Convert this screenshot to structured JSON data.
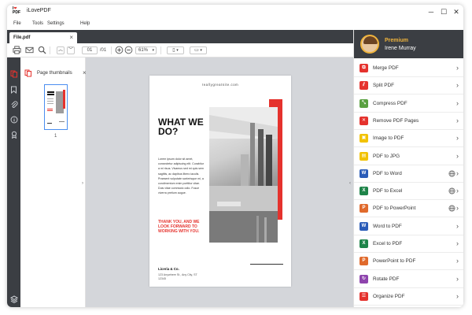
{
  "app": {
    "title": "iLovePDF",
    "logo_text": "I❤PDF"
  },
  "window_controls": {
    "minimize": "─",
    "maximize": "☐",
    "close": "✕"
  },
  "menu": [
    "File",
    "Tools",
    "Settings",
    "Help"
  ],
  "tab": {
    "label": "File.pdf",
    "close": "×"
  },
  "toolbar": {
    "page_current": "01",
    "page_total": "/01",
    "zoom": "61%",
    "icons": [
      "print-icon",
      "mail-icon",
      "search-icon",
      "page-up-icon",
      "page-down-icon",
      "zoom-in-icon",
      "zoom-out-icon",
      "page-view-icon",
      "rotate-page-icon"
    ]
  },
  "left_rail": {
    "icons": [
      "thumbnails-icon",
      "bookmark-icon",
      "attachment-icon",
      "info-icon",
      "signature-icon",
      "layers-icon"
    ]
  },
  "thumbnail_panel": {
    "title": "Page thumbnails",
    "close": "×",
    "page_number": "1"
  },
  "document": {
    "url": "reallygreatsite.com",
    "headline": "WHAT WE DO?",
    "body": "Lorem ipsum dolor sit amet, consectetur adipiscing elit. Curabitur a mi risus. Vivamus sed mi quis sem sagittis, ac dapibus libero iaculis. Praesent vulputate scelerisque mi, a condimentum enim porttitor vitae. Duis vitae commodo odio. Fusce viverra pretium augue.",
    "red_text": "THANK YOU, AND WE LOOK FORWARD TO WORKING WITH YOU.",
    "company": "Liceria & Co.",
    "address": "123 Anywhere St., Any City, ST 12345"
  },
  "profile": {
    "tier": "Premium",
    "name": "Irene Murray"
  },
  "tools": [
    {
      "label": "Merge PDF",
      "color": "#e5322d",
      "glyph": "⧉",
      "globe": false
    },
    {
      "label": "Split PDF",
      "color": "#e5322d",
      "glyph": "⫽",
      "globe": false
    },
    {
      "label": "Compress PDF",
      "color": "#5ba142",
      "glyph": "⤡",
      "globe": false
    },
    {
      "label": "Remove PDF Pages",
      "color": "#e5322d",
      "glyph": "✕",
      "globe": false
    },
    {
      "label": "Image to PDF",
      "color": "#f2c200",
      "glyph": "▣",
      "globe": false
    },
    {
      "label": "PDF to JPG",
      "color": "#f2c200",
      "glyph": "▤",
      "globe": false
    },
    {
      "label": "PDF to Word",
      "color": "#2a5cb8",
      "glyph": "W",
      "globe": true
    },
    {
      "label": "PDF to Excel",
      "color": "#1e8449",
      "glyph": "X",
      "globe": true
    },
    {
      "label": "PDF to PowerPoint",
      "color": "#e06a2c",
      "glyph": "P",
      "globe": true
    },
    {
      "label": "Word to PDF",
      "color": "#2a5cb8",
      "glyph": "W",
      "globe": false
    },
    {
      "label": "Excel to PDF",
      "color": "#1e8449",
      "glyph": "X",
      "globe": false
    },
    {
      "label": "PowerPoint to PDF",
      "color": "#e06a2c",
      "glyph": "P",
      "globe": false
    },
    {
      "label": "Rotate PDF",
      "color": "#8e44ad",
      "glyph": "↻",
      "globe": false
    },
    {
      "label": "Organize PDF",
      "color": "#e5322d",
      "glyph": "☰",
      "globe": false
    }
  ]
}
